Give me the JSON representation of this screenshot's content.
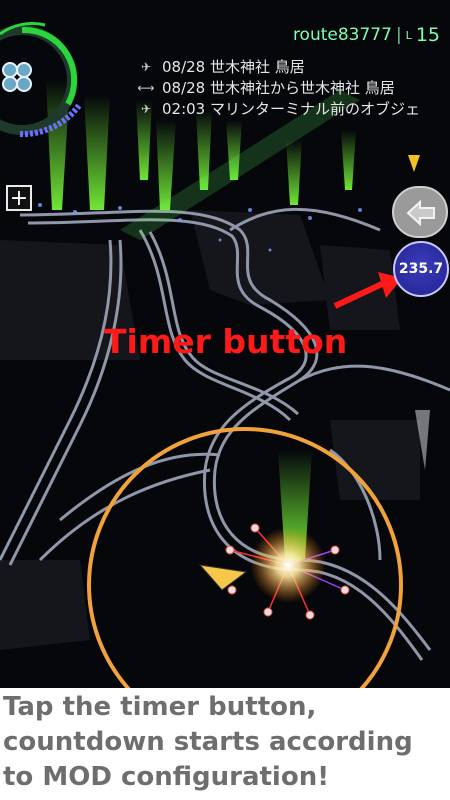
{
  "agent": {
    "name": "route83777",
    "level_prefix": "L",
    "level": "15"
  },
  "comm": [
    {
      "icon": "resonator-icon",
      "glyph": "✈",
      "text": "08/28 世木神社 鳥居"
    },
    {
      "icon": "link-icon",
      "glyph": "⟷",
      "text": "08/28 世木神社から世木神社 鳥居"
    },
    {
      "icon": "resonator-icon",
      "glyph": "✈",
      "text": "02:03 マリンターミナル前のオブジェ"
    }
  ],
  "controls": {
    "plus": "+",
    "timer_value": "235.7"
  },
  "annotation": {
    "label": "Timer button"
  },
  "caption": {
    "lines": [
      "Tap the timer button,",
      "countdown starts according",
      "to MOD configuration!"
    ]
  },
  "colors": {
    "accent": "#7dffb0",
    "annotation": "#ff1a1a",
    "timer": "#2a2aa0",
    "range_ring": "#f2a23a"
  }
}
